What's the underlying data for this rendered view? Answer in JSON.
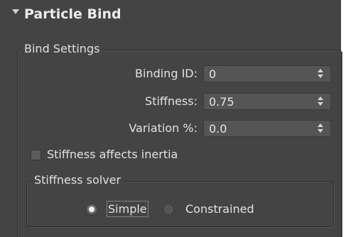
{
  "rollout": {
    "title": "Particle Bind",
    "expanded": true,
    "icon": "collapse-arrow-icon"
  },
  "bind_settings": {
    "title": "Bind Settings",
    "fields": [
      {
        "label": "Binding ID:",
        "value": "0"
      },
      {
        "label": "Stiffness:",
        "value": "0.75"
      },
      {
        "label": "Variation %:",
        "value": "0.0"
      }
    ],
    "inertia_checkbox": {
      "label": "Stiffness affects inertia",
      "checked": false
    },
    "solver": {
      "title": "Stiffness solver",
      "options": [
        {
          "label": "Simple",
          "selected": true
        },
        {
          "label": "Constrained",
          "selected": false
        }
      ]
    }
  },
  "colors": {
    "panel_bg": "#444444",
    "field_bg": "#555555",
    "text": "#e2e2e2"
  }
}
